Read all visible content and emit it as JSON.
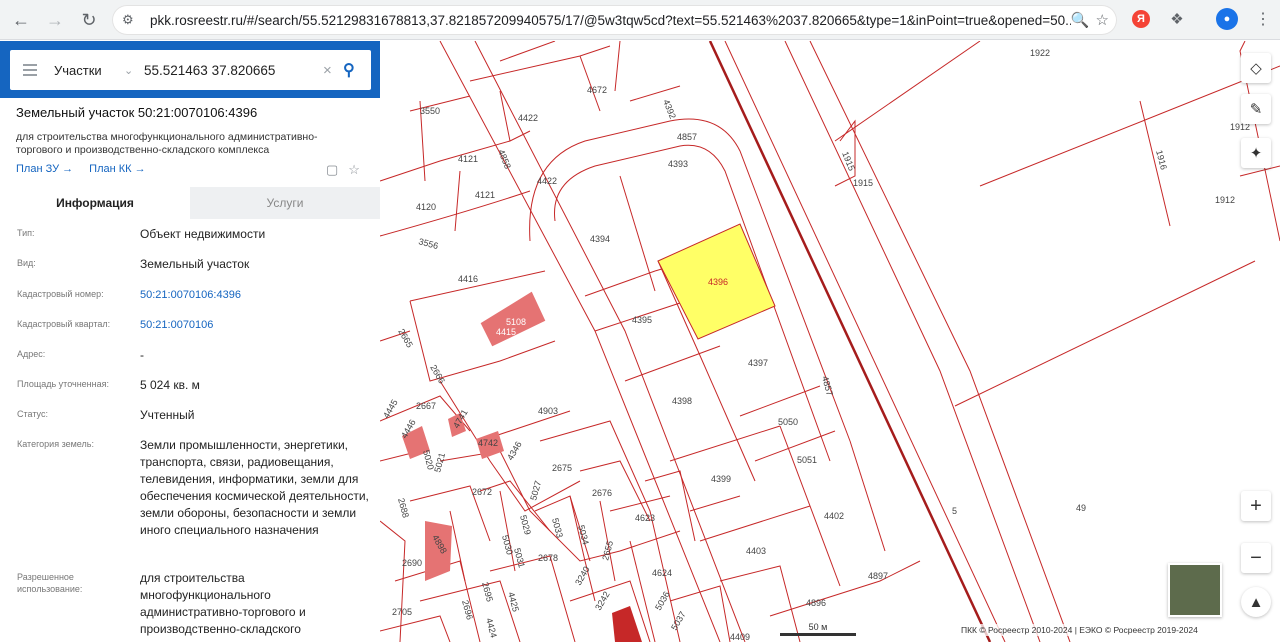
{
  "browser": {
    "url": "pkk.rosreestr.ru/#/search/55.52129831678813,37.821857209940575/17/@5w3tqw5cd?text=55.521463%2037.820665&type=1&inPoint=true&opened=50..."
  },
  "search": {
    "type_label": "Участки",
    "value": "55.521463 37.820665"
  },
  "parcel": {
    "title": "Земельный участок 50:21:0070106:4396",
    "description": "для строительства многофункционального административно-торгового и производственно-складского комплекса",
    "link_plan_zu": "План ЗУ",
    "link_plan_kk": "План КК"
  },
  "tabs": {
    "info": "Информация",
    "services": "Услуги"
  },
  "properties": [
    {
      "label": "Тип:",
      "value": "Объект недвижимости"
    },
    {
      "label": "Вид:",
      "value": "Земельный участок"
    },
    {
      "label": "Кадастровый номер:",
      "value": "50:21:0070106:4396"
    },
    {
      "label": "Кадастровый квартал:",
      "value": "50:21:0070106"
    },
    {
      "label": "Адрес:",
      "value": "-"
    },
    {
      "label": "Площадь уточненная:",
      "value": "5 024 кв. м"
    },
    {
      "label": "Статус:",
      "value": "Учтенный"
    },
    {
      "label": "Категория земель:",
      "value": "Земли промышленности, энергетики, транспорта, связи, радиовещания, телевидения, информатики, земли для обеспечения космической деятельности, земли обороны, безопасности и земли иного специального назначения"
    },
    {
      "label": "Разрешенное использование:",
      "value": "для строительства многофункционального административно-торгового и производственно-складского"
    }
  ],
  "map": {
    "parcel_labels": [
      "1922",
      "4672",
      "4392",
      "3550",
      "4422",
      "4857",
      "1915",
      "1912",
      "1916",
      "4121",
      "4858",
      "4393",
      "1915",
      "4422",
      "4120",
      "4121",
      "1912",
      "4394",
      "3556",
      "4396",
      "4416",
      "5108",
      "4415",
      "4395",
      "2665",
      "4397",
      "2666",
      "4857",
      "2667",
      "4903",
      "4398",
      "5050",
      "4445",
      "4741",
      "4742",
      "4346",
      "5051",
      "2675",
      "4399",
      "2672",
      "2676",
      "4402",
      "5027",
      "4623",
      "5030",
      "5029",
      "5033",
      "5034",
      "5031",
      "2678",
      "4403",
      "2690",
      "2655",
      "4624",
      "4897",
      "2695",
      "4425",
      "3240",
      "2696",
      "4896",
      "2705",
      "3242",
      "5036",
      "4424",
      "4409",
      "5037",
      "49",
      "5",
      "4898",
      "2688",
      "5020",
      "5021",
      "4446"
    ],
    "selected_label": "4396",
    "scale_label": "50 м",
    "copyright": "ПКК © Росреестр 2010-2024 | ЕЭКО © Росреестр 2019-2024",
    "colors": {
      "boundary": "#c62828",
      "selected_fill": "#ffff66",
      "building": "#e57373"
    }
  }
}
